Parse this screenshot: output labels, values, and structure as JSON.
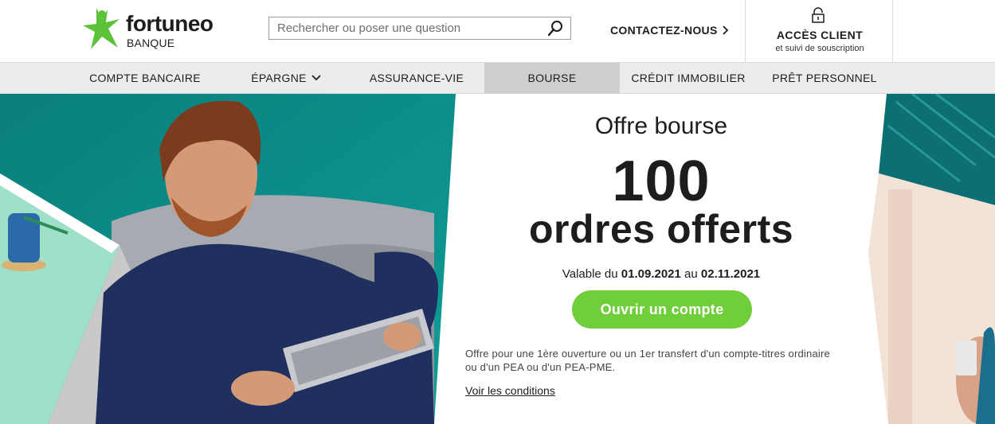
{
  "header": {
    "logo_word": "fortuneo",
    "logo_sub": "BANQUE",
    "search_placeholder": "Rechercher ou poser une question",
    "contact_label": "CONTACTEZ-NOUS",
    "client_title": "ACCÈS CLIENT",
    "client_sub": "et suivi de souscription"
  },
  "nav": {
    "items": [
      {
        "label": "COMPTE BANCAIRE"
      },
      {
        "label": "ÉPARGNE"
      },
      {
        "label": "ASSURANCE-VIE"
      },
      {
        "label": "BOURSE"
      },
      {
        "label": "CRÉDIT IMMOBILIER"
      },
      {
        "label": "PRÊT PERSONNEL"
      }
    ],
    "active": "BOURSE"
  },
  "hero": {
    "title": "Offre bourse",
    "big_number": "100",
    "big_text": "ordres offerts",
    "validity_prefix": "Valable du",
    "date_start": "01.09.2021",
    "validity_mid": "au",
    "date_end": "02.11.2021",
    "cta": "Ouvrir un compte",
    "note": "Offre pour une 1ère ouverture ou un 1er transfert d'un compte-titres ordinaire ou d'un PEA ou d'un PEA-PME.",
    "conditions": "Voir les conditions"
  },
  "colors": {
    "brand_green": "#6fce3a",
    "teal": "#0b8f8b",
    "nav_bg": "#ececec",
    "nav_active": "#cfcfcf"
  },
  "icons": [
    "star-logo-icon",
    "search-icon",
    "chevron-right-icon",
    "lock-icon",
    "chevron-down-icon"
  ]
}
